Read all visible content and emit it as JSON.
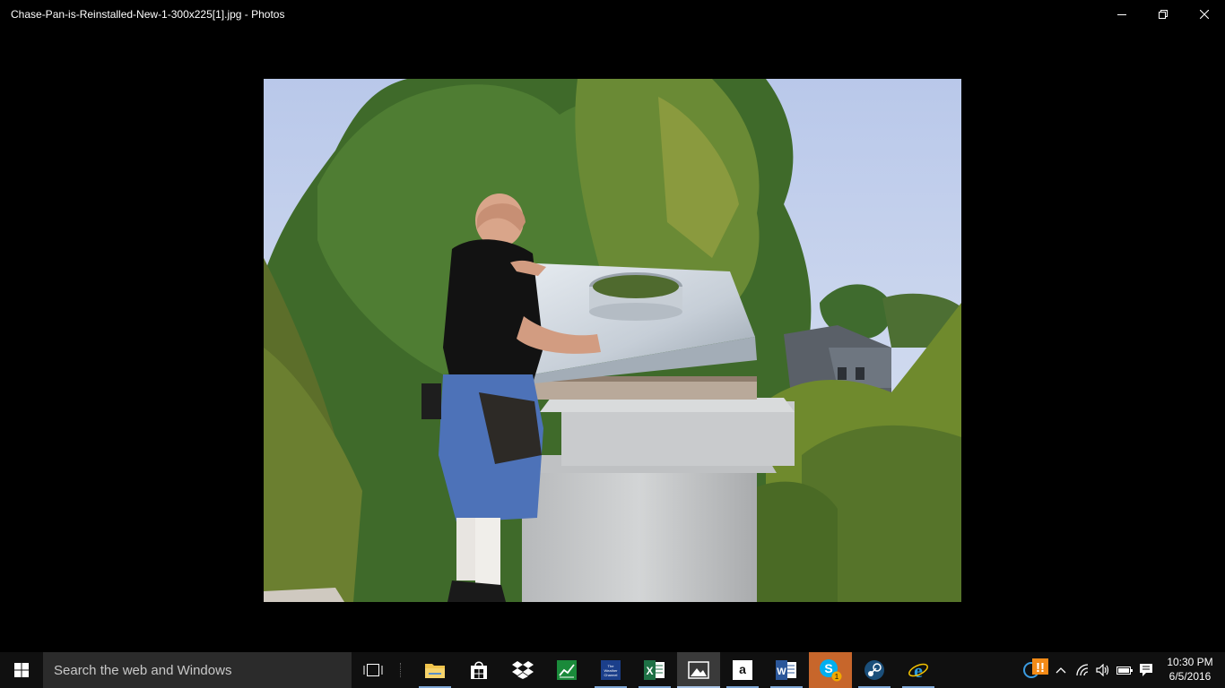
{
  "window": {
    "title": "Chase-Pan-is-Reinstalled-New-1-300x225[1].jpg - Photos",
    "controls": [
      "minimize-icon",
      "restore-icon",
      "close-icon"
    ]
  },
  "photo": {
    "subject": "photograph"
  },
  "taskbar": {
    "search_placeholder": "Search the web and Windows",
    "apps": [
      {
        "name": "file-explorer",
        "icon": "folder-icon",
        "running": true
      },
      {
        "name": "store",
        "icon": "store-icon",
        "running": false
      },
      {
        "name": "dropbox",
        "icon": "dropbox-icon",
        "running": false
      },
      {
        "name": "money",
        "icon": "chart-app-icon",
        "running": false
      },
      {
        "name": "weather-channel",
        "icon": "weather-channel-icon",
        "label": "The Weather Channel",
        "running": true
      },
      {
        "name": "excel",
        "icon": "excel-icon",
        "running": true
      },
      {
        "name": "photos",
        "icon": "photos-icon",
        "running": true,
        "active": true
      },
      {
        "name": "amazon",
        "icon": "amazon-icon",
        "label": "a",
        "running": true
      },
      {
        "name": "word",
        "icon": "word-icon",
        "running": true
      },
      {
        "name": "skype",
        "icon": "skype-icon",
        "badge": "1",
        "running": true
      },
      {
        "name": "steam",
        "icon": "steam-icon",
        "running": true
      },
      {
        "name": "internet-explorer",
        "icon": "ie-icon",
        "running": true
      }
    ],
    "tray": {
      "icons": [
        "update-icon",
        "warning-icon",
        "chevron-up-icon",
        "wifi-icon",
        "volume-icon",
        "battery-icon",
        "notifications-icon"
      ],
      "time": "10:30 PM",
      "date": "6/5/2016"
    }
  }
}
